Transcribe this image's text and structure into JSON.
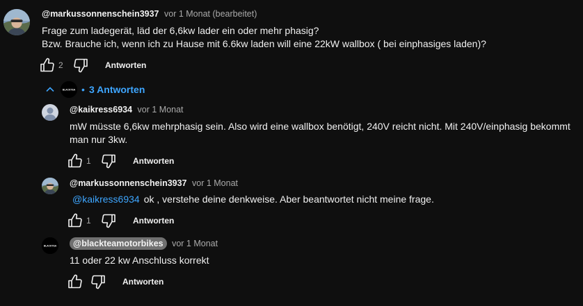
{
  "comment": {
    "author": "@markussonnenschein3937",
    "time": "vor 1 Monat (bearbeitet)",
    "text_line1": "Frage zum ladegerät, läd der 6,6kw lader ein oder mehr phasig?",
    "text_line2": "Bzw. Brauche ich, wenn ich zu Hause mit 6.6kw laden will eine 22kW wallbox ( bei einphasiges laden)?",
    "like_count": "2",
    "reply_label": "Antworten"
  },
  "replies_toggle": {
    "dot": "•",
    "label": "3 Antworten",
    "avatar_text": "BLACKTEA"
  },
  "replies": [
    {
      "author": "@kaikress6934",
      "time": "vor 1 Monat",
      "text_line1": "mW müsste 6,6kw mehrphasig sein. Also wird eine wallbox benötigt, 240V reicht nicht. Mit 240V/einphasig bekommt",
      "text_line2": "man nur 3kw.",
      "like_count": "1",
      "reply_label": "Antworten"
    },
    {
      "author": "@markussonnenschein3937",
      "time": "vor 1 Monat",
      "mention": "@kaikress6934",
      "text": "ok , verstehe deine denkweise. Aber beantwortet nicht meine frage.",
      "like_count": "1",
      "reply_label": "Antworten"
    },
    {
      "author": "@blackteamotorbikes",
      "time": "vor 1 Monat",
      "avatar_text": "BLACKTEA",
      "text": "11 oder 22 kw Anschluss korrekt",
      "reply_label": "Antworten"
    }
  ],
  "colors": {
    "background": "#0f0f0f",
    "text": "#f1f1f1",
    "secondary": "#aaaaaa",
    "link": "#3ea6ff",
    "chip": "#707070"
  },
  "icons": {
    "like": "thumbs-up-icon",
    "dislike": "thumbs-down-icon",
    "collapse": "chevron-up-icon"
  }
}
